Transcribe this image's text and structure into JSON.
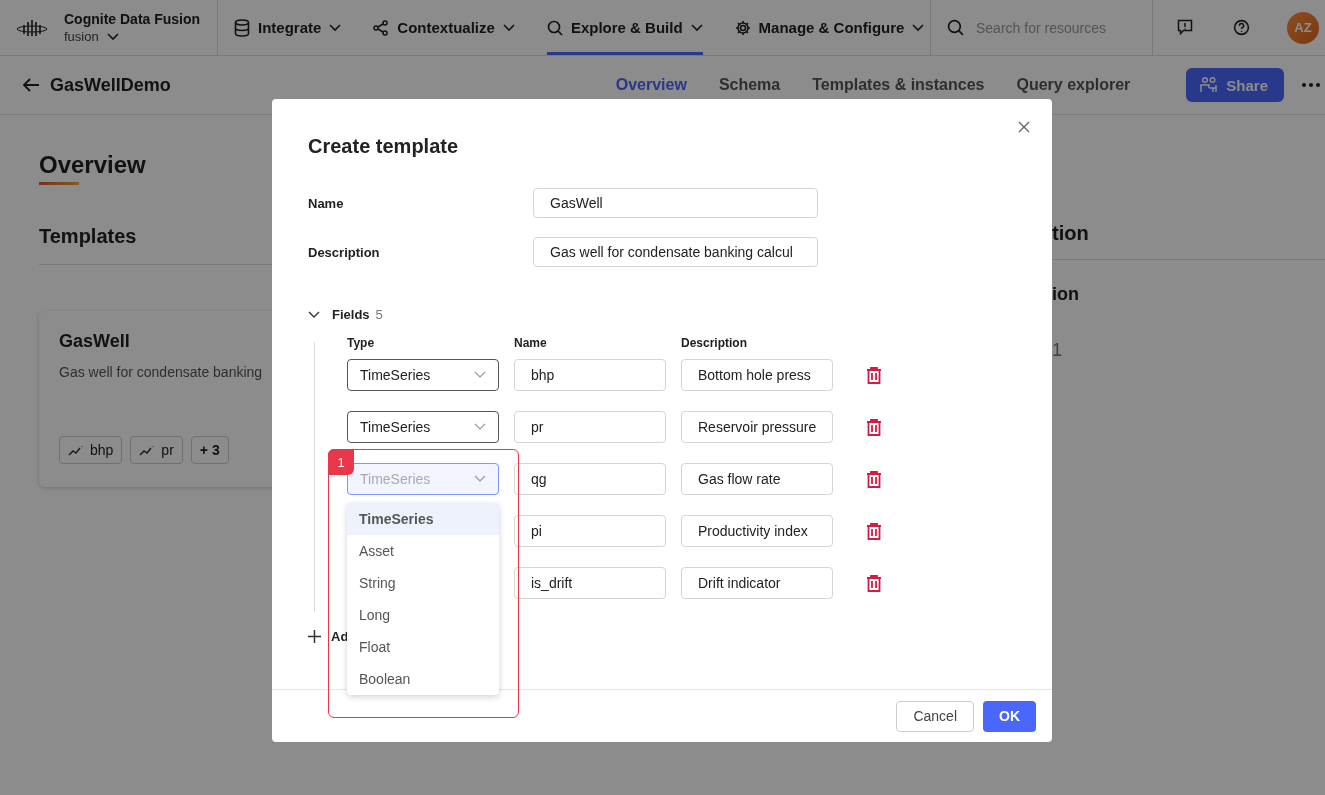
{
  "app": {
    "title": "Cognite Data Fusion",
    "project": "fusion"
  },
  "nav": [
    {
      "label": "Integrate",
      "selected": false
    },
    {
      "label": "Contextualize",
      "selected": false
    },
    {
      "label": "Explore & Build",
      "selected": true
    },
    {
      "label": "Manage & Configure",
      "selected": false
    }
  ],
  "search": {
    "placeholder": "Search for resources"
  },
  "user": {
    "initials": "AZ"
  },
  "page": {
    "title": "GasWellDemo",
    "share": "Share",
    "tabs": [
      {
        "label": "Overview",
        "selected": true
      },
      {
        "label": "Schema",
        "selected": false
      },
      {
        "label": "Templates & instances",
        "selected": false
      },
      {
        "label": "Query explorer",
        "selected": false
      }
    ]
  },
  "overview": {
    "heading": "Overview",
    "section": "Templates",
    "card": {
      "title": "GasWell",
      "description": "Gas well for condensate banking",
      "chips": [
        {
          "label": "bhp",
          "kind": "timeseries"
        },
        {
          "label": "pr",
          "kind": "timeseries"
        },
        {
          "label": "+ 3",
          "kind": "more"
        }
      ]
    }
  },
  "side": {
    "heading": "tion",
    "subheading": "ion",
    "count": "1"
  },
  "modal": {
    "title": "Create template",
    "name_label": "Name",
    "name_value": "GasWell",
    "description_label": "Description",
    "description_value": "Gas well for condensate banking calcul",
    "fields": {
      "label": "Fields",
      "count": "5",
      "expanded": true,
      "columns": [
        "Type",
        "Name",
        "Description"
      ],
      "rows": [
        {
          "type": "TimeSeries",
          "open": false,
          "name": "bhp",
          "description": "Bottom hole press"
        },
        {
          "type": "TimeSeries",
          "open": false,
          "name": "pr",
          "description": "Reservoir pressure"
        },
        {
          "type": "TimeSeries",
          "open": true,
          "name": "qg",
          "description": "Gas flow rate"
        },
        {
          "name": "pi",
          "description": "Productivity index"
        },
        {
          "name": "is_drift",
          "description": "Drift indicator"
        }
      ],
      "add": "Ad"
    },
    "dropdown": {
      "options": [
        {
          "label": "TimeSeries",
          "selected": true
        },
        {
          "label": "Asset",
          "selected": false
        },
        {
          "label": "String",
          "selected": false
        },
        {
          "label": "Long",
          "selected": false
        },
        {
          "label": "Float",
          "selected": false
        },
        {
          "label": "Boolean",
          "selected": false
        }
      ]
    },
    "cancel": "Cancel",
    "ok": "OK"
  },
  "annotation": {
    "label": "1"
  }
}
